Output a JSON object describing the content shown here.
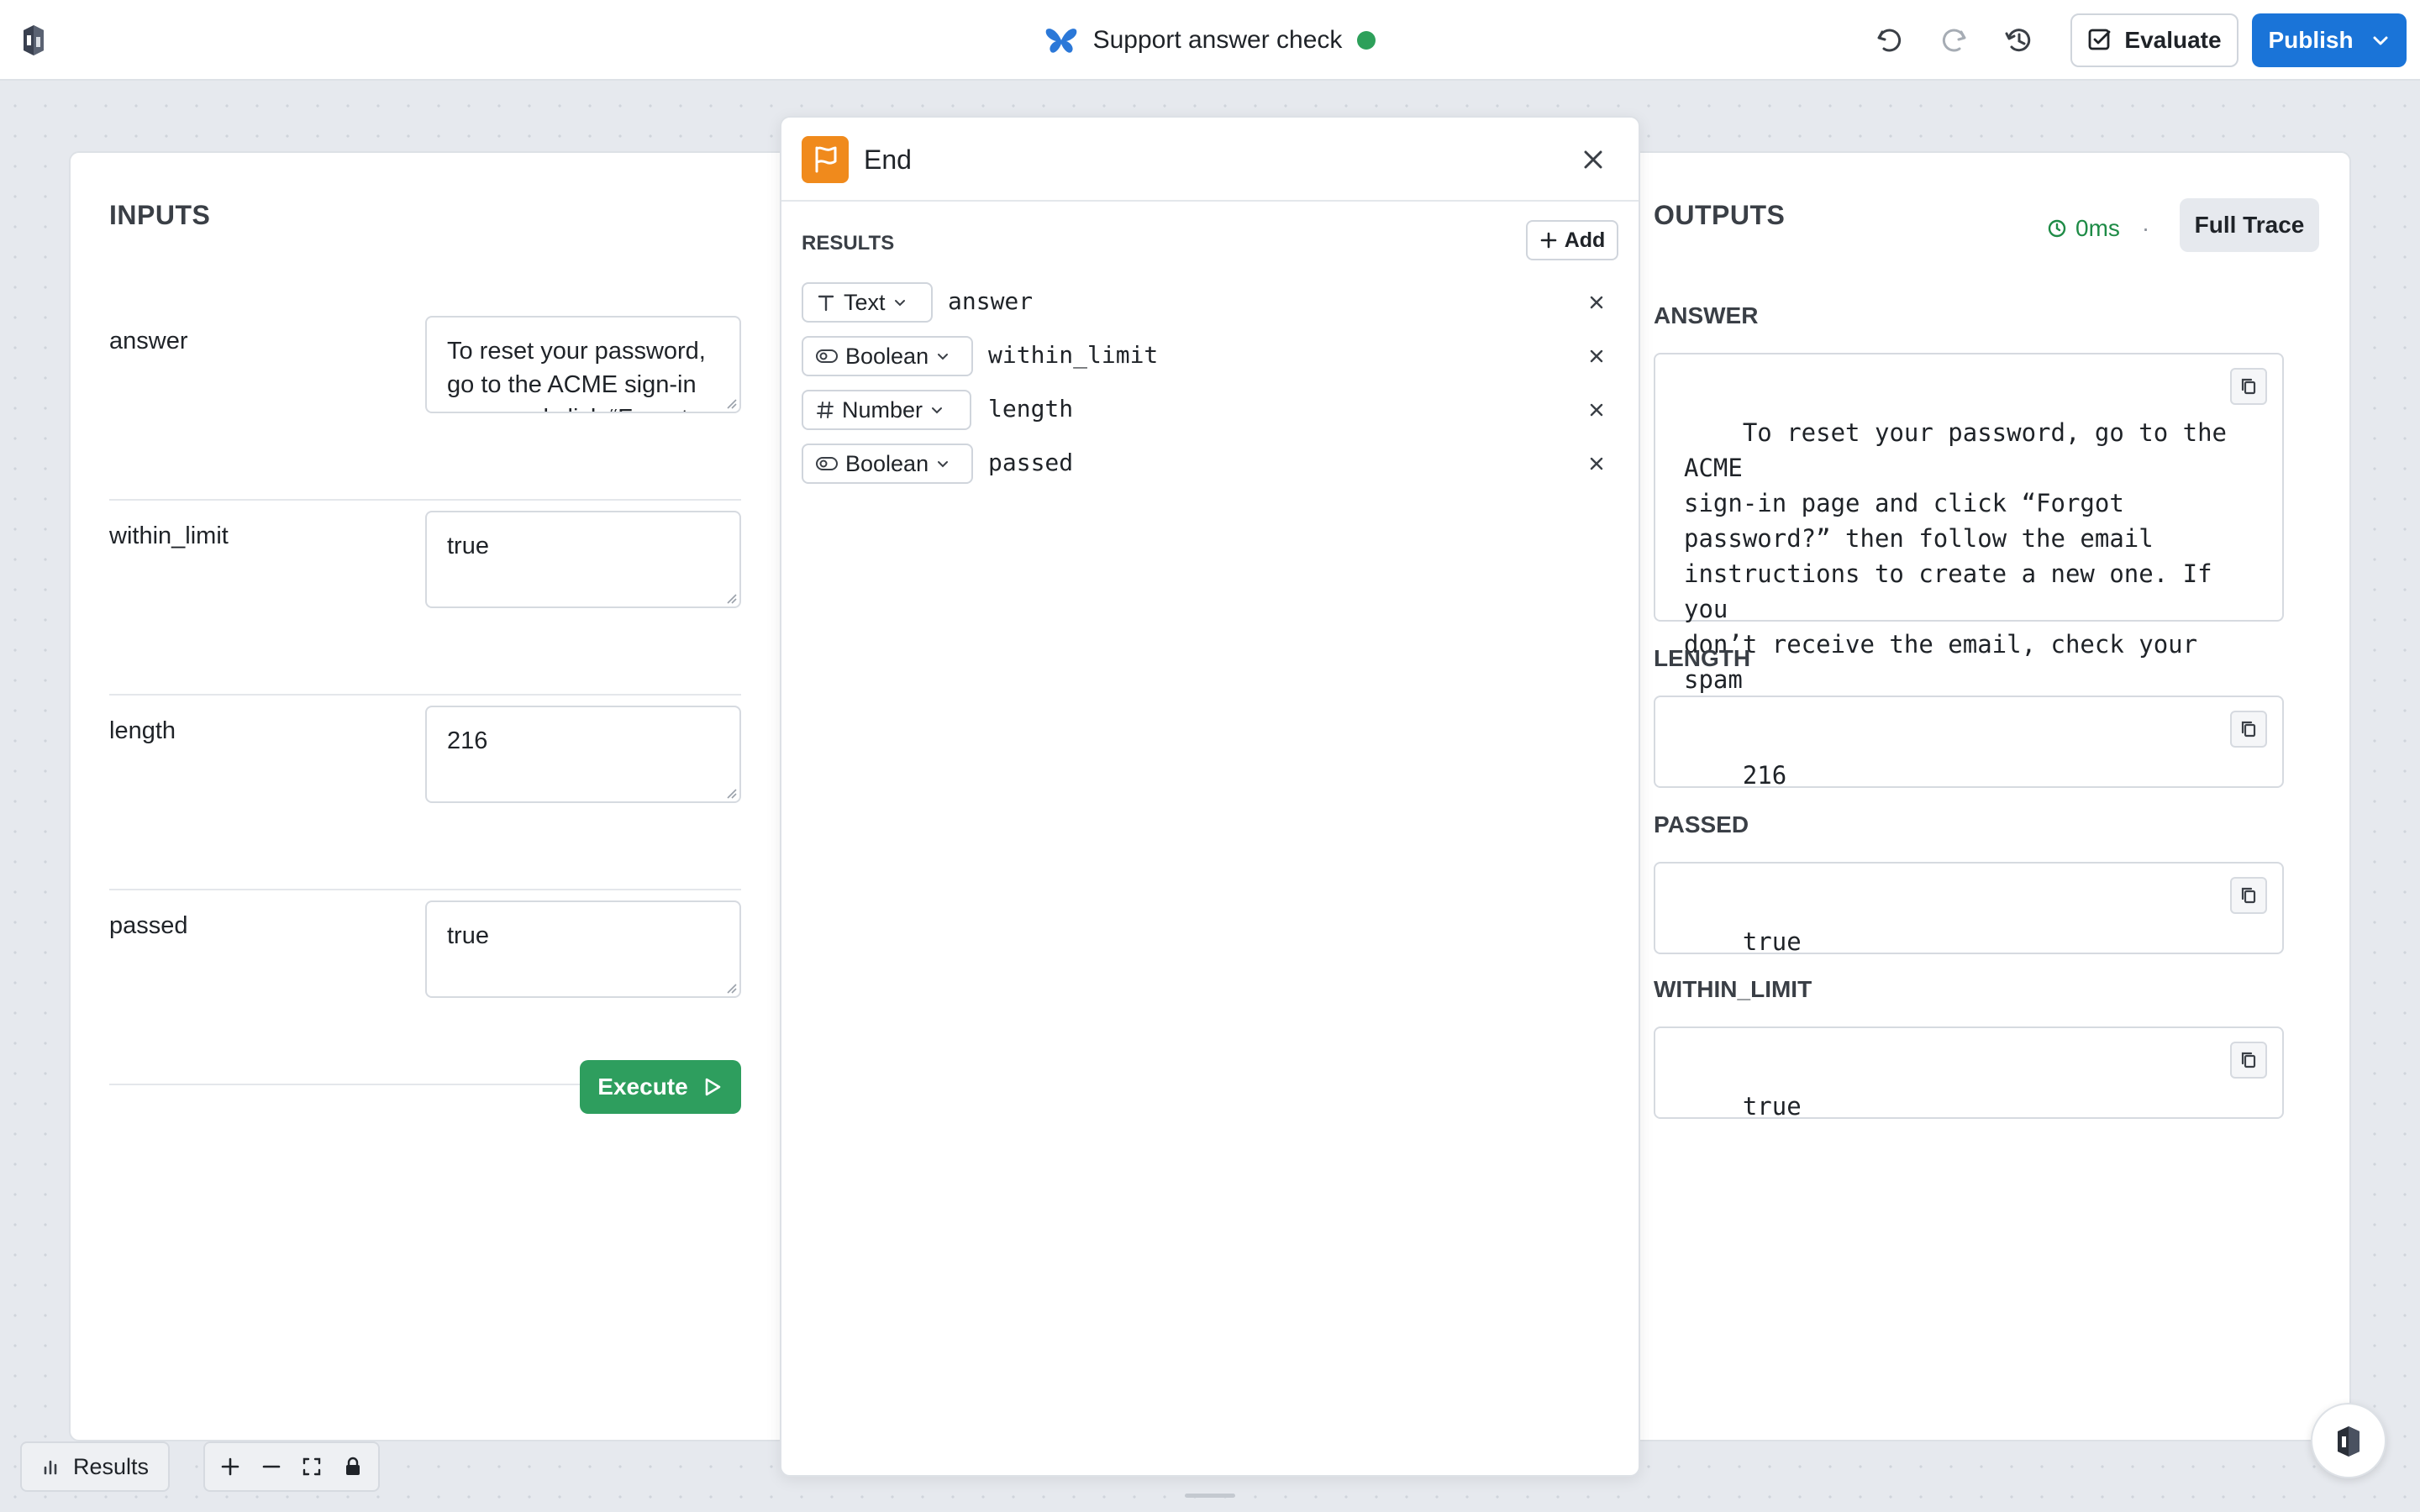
{
  "header": {
    "title": "Support answer check",
    "status_color": "#2da05a",
    "evaluate_label": "Evaluate",
    "publish_label": "Publish",
    "icons": [
      "app-logo-icon",
      "butterfly-icon",
      "undo-icon",
      "redo-icon",
      "history-icon",
      "checkbox-icon",
      "chevron-down-icon"
    ]
  },
  "inputs": {
    "heading": "INPUTS",
    "fields": [
      {
        "label": "answer",
        "value": "To reset your password, go to the ACME sign-in page and click “Forgot password?”"
      },
      {
        "label": "within_limit",
        "value": "true"
      },
      {
        "label": "length",
        "value": "216"
      },
      {
        "label": "passed",
        "value": "true"
      }
    ],
    "execute_label": "Execute"
  },
  "end_panel": {
    "title": "End",
    "results_heading": "RESULTS",
    "add_label": "Add",
    "results": [
      {
        "type": "Text",
        "type_icon": "text-type-icon",
        "name": "answer"
      },
      {
        "type": "Boolean",
        "type_icon": "toggle-icon",
        "name": "within_limit"
      },
      {
        "type": "Number",
        "type_icon": "hash-icon",
        "name": "length"
      },
      {
        "type": "Boolean",
        "type_icon": "toggle-icon",
        "name": "passed"
      }
    ]
  },
  "outputs": {
    "heading": "OUTPUTS",
    "timing": "0ms",
    "trace_label": "Full Trace",
    "items": [
      {
        "label": "ANSWER",
        "value": "To reset your password, go to the ACME\nsign-in page and click “Forgot\npassword?” then follow the email\ninstructions to create a new one. If you\ndon’t receive the email, check your spam\nfolder or contact ACME support."
      },
      {
        "label": "LENGTH",
        "value": "216"
      },
      {
        "label": "PASSED",
        "value": "true"
      },
      {
        "label": "WITHIN_LIMIT",
        "value": "true"
      }
    ]
  },
  "footer": {
    "results_label": "Results",
    "zoom_controls": [
      "zoom-in-icon",
      "zoom-out-icon",
      "fit-view-icon",
      "lock-icon"
    ]
  },
  "colors": {
    "accent": "#1a74d8",
    "execute": "#2e9e5e",
    "end_badge": "#f08a1c",
    "timing": "#1e8b46"
  }
}
